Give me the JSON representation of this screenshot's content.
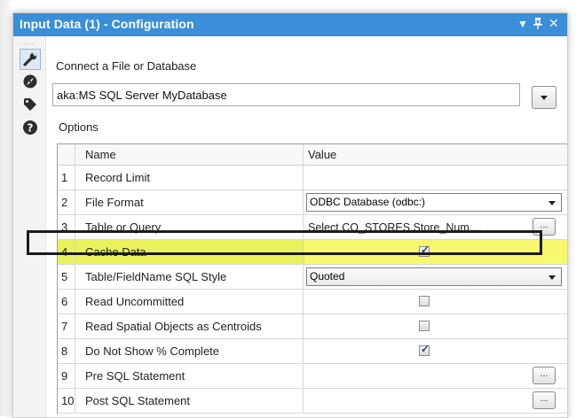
{
  "window": {
    "title": "Input Data (1) - Configuration"
  },
  "sidebar": {
    "dots": "....",
    "icons": [
      "wrench-icon",
      "compass-icon",
      "tag-icon",
      "help-icon"
    ]
  },
  "connect": {
    "label": "Connect a File or Database",
    "value": "aka:MS SQL Server MyDatabase"
  },
  "options": {
    "label": "Options",
    "columns": {
      "name": "Name",
      "value": "Value"
    },
    "rows": [
      {
        "num": "1",
        "name": "Record Limit",
        "value": ""
      },
      {
        "num": "2",
        "name": "File Format",
        "value": "ODBC Database (odbc:)"
      },
      {
        "num": "3",
        "name": "Table or Query",
        "value": "Select  CO_STORES.Store_Num,..."
      },
      {
        "num": "4",
        "name": "Cache Data",
        "checked": true
      },
      {
        "num": "5",
        "name": "Table/FieldName SQL Style",
        "value": "Quoted"
      },
      {
        "num": "6",
        "name": "Read Uncommitted",
        "checked": false
      },
      {
        "num": "7",
        "name": "Read Spatial Objects as Centroids",
        "checked": false
      },
      {
        "num": "8",
        "name": "Do Not Show % Complete",
        "checked": true
      },
      {
        "num": "9",
        "name": "Pre SQL Statement",
        "value": ""
      },
      {
        "num": "10",
        "name": "Post SQL Statement",
        "value": ""
      }
    ],
    "ellipsis_label": "..."
  },
  "colors": {
    "titlebar": "#3a8fd8",
    "highlight": "#e9f25a"
  }
}
